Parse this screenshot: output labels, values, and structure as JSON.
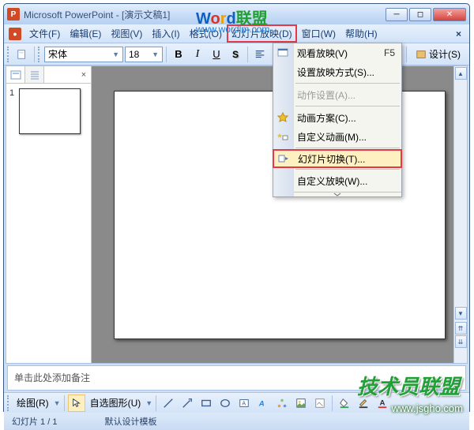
{
  "title": "Microsoft PowerPoint - [演示文稿1]",
  "menubar": {
    "file": "文件(F)",
    "edit": "编辑(E)",
    "view": "视图(V)",
    "insert": "插入(I)",
    "format": "格式(O)",
    "slideshow": "幻灯片放映(D)",
    "window": "窗口(W)",
    "help": "帮助(H)"
  },
  "toolbar": {
    "font_name": "宋体",
    "font_size": "18",
    "bold": "B",
    "italic": "I",
    "underline": "U",
    "shadow": "S",
    "design": "设计(S)"
  },
  "thumbs": {
    "slide_num": "1"
  },
  "dropdown": {
    "view_show": "观看放映(V)",
    "view_show_shortcut": "F5",
    "setup_show": "设置放映方式(S)...",
    "action_settings": "动作设置(A)...",
    "animation_schemes": "动画方案(C)...",
    "custom_animation": "自定义动画(M)...",
    "slide_transition": "幻灯片切换(T)...",
    "custom_shows": "自定义放映(W)..."
  },
  "notes": {
    "placeholder": "单击此处添加备注"
  },
  "drawbar": {
    "draw": "绘图(R)",
    "autoshapes": "自选图形(U)"
  },
  "statusbar": {
    "slide_count": "幻灯片 1 / 1",
    "template": "默认设计模板"
  },
  "watermarks": {
    "wordlm_w": "W",
    "wordlm_o": "o",
    "wordlm_r": "r",
    "wordlm_d": "d",
    "wordlm_lm": "联盟",
    "url": "www.wordlm.com",
    "jsy": "技术员联盟",
    "jsgho": "www.jsgho.com"
  }
}
